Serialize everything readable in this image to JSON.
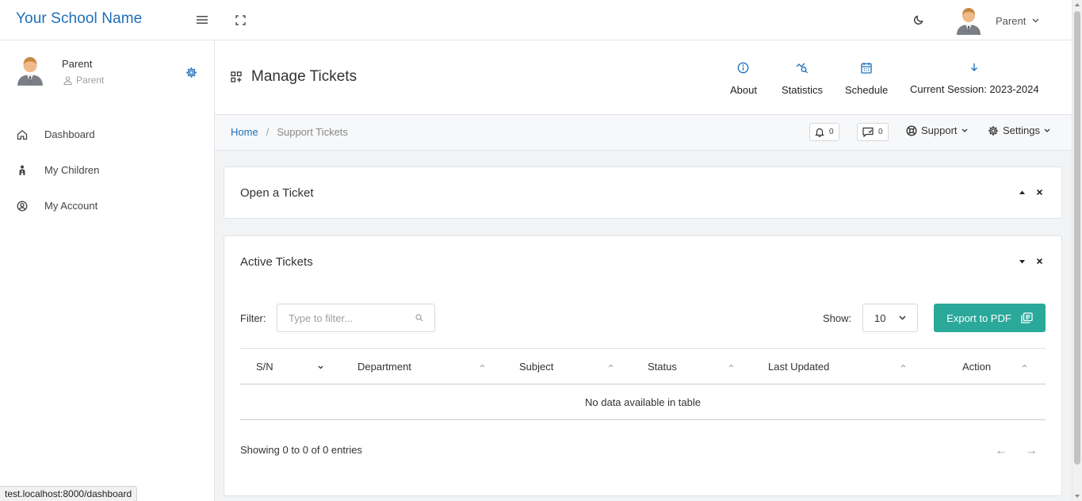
{
  "header": {
    "brand": "Your School Name",
    "user_name": "Parent",
    "icons": {
      "menu": "hamburger-icon",
      "fullscreen": "fullscreen-icon",
      "theme": "moon-icon"
    }
  },
  "sidebar": {
    "profile_name": "Parent",
    "profile_role": "Parent",
    "items": [
      {
        "label": "Dashboard",
        "icon": "home-icon"
      },
      {
        "label": "My Children",
        "icon": "child-icon"
      },
      {
        "label": "My Account",
        "icon": "user-circle-icon"
      }
    ]
  },
  "page": {
    "title": "Manage Tickets",
    "links": [
      {
        "label": "About",
        "icon": "info-icon"
      },
      {
        "label": "Statistics",
        "icon": "stats-icon"
      },
      {
        "label": "Schedule",
        "icon": "calendar-icon"
      },
      {
        "label": "Current Session: 2023-2024",
        "icon": "arrow-down-icon"
      }
    ]
  },
  "breadcrumb": {
    "home": "Home",
    "separator": "/",
    "current": "Support Tickets",
    "notifications_count": "0",
    "messages_count": "0",
    "support_label": "Support",
    "settings_label": "Settings"
  },
  "open_ticket": {
    "title": "Open a Ticket"
  },
  "active_tickets": {
    "title": "Active Tickets",
    "filter_label": "Filter:",
    "filter_placeholder": "Type to filter...",
    "show_label": "Show:",
    "show_value": "10",
    "export_label": "Export to PDF",
    "columns": [
      "S/N",
      "Department",
      "Subject",
      "Status",
      "Last Updated",
      "Action"
    ],
    "empty_text": "No data available in table",
    "info_text": "Showing 0 to 0 of 0 entries",
    "prev_arrow": "←",
    "next_arrow": "→"
  },
  "status_url": "test.localhost:8000/dashboard",
  "colors": {
    "brand": "#1e6fb8",
    "accent": "#2aa89a"
  }
}
